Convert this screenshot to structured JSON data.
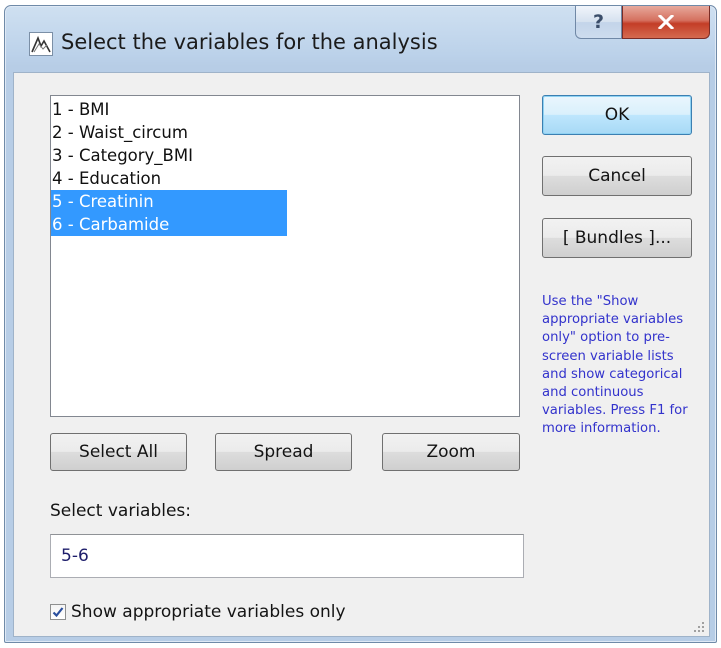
{
  "window": {
    "title": "Select the variables for the analysis",
    "help_label": "?",
    "close_label": "X",
    "icon": "chart-app-icon"
  },
  "variables": {
    "items": [
      {
        "label": "1 - BMI",
        "selected": false
      },
      {
        "label": "2 - Waist_circum",
        "selected": false
      },
      {
        "label": "3 - Category_BMI",
        "selected": false
      },
      {
        "label": "4 - Education",
        "selected": false
      },
      {
        "label": "5 - Creatinin",
        "selected": true
      },
      {
        "label": "6 - Carbamide",
        "selected": true
      }
    ],
    "selection_color": "#3399ff"
  },
  "buttons": {
    "ok": "OK",
    "cancel": "Cancel",
    "bundles": "[ Bundles ]...",
    "select_all": "Select All",
    "spread": "Spread",
    "zoom": "Zoom"
  },
  "help_text": "Use the \"Show appropriate variables only\" option to pre-screen variable lists and show categorical and continuous variables. Press F1 for more information.",
  "select_variables": {
    "label": "Select variables:",
    "value": "5-6"
  },
  "show_appropriate": {
    "label": "Show appropriate variables only",
    "checked": true
  },
  "colors": {
    "help_text": "#3333cc",
    "close_button": "#c33d27",
    "title_bar": "#bcd2ea"
  }
}
